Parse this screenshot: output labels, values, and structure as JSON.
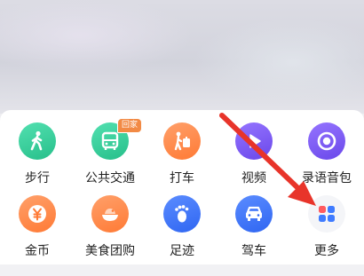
{
  "colors": {
    "green": "#3dcf9c",
    "orange": "#ff8a4a",
    "purple": "#7f5af0",
    "blue": "#3f7bff",
    "arrow": "#e8342a"
  },
  "services": [
    {
      "label": "步行",
      "icon": "walking-person-icon"
    },
    {
      "label": "公共交通",
      "icon": "bus-icon",
      "badge": "回家"
    },
    {
      "label": "打车",
      "icon": "taxi-passenger-icon"
    },
    {
      "label": "视频",
      "icon": "play-video-icon"
    },
    {
      "label": "录语音包",
      "icon": "record-icon"
    },
    {
      "label": "金币",
      "icon": "yuan-coin-icon"
    },
    {
      "label": "美食团购",
      "icon": "food-bowl-icon"
    },
    {
      "label": "足迹",
      "icon": "footprint-icon"
    },
    {
      "label": "驾车",
      "icon": "car-icon"
    },
    {
      "label": "更多",
      "icon": "four-dots-grid-icon"
    }
  ]
}
